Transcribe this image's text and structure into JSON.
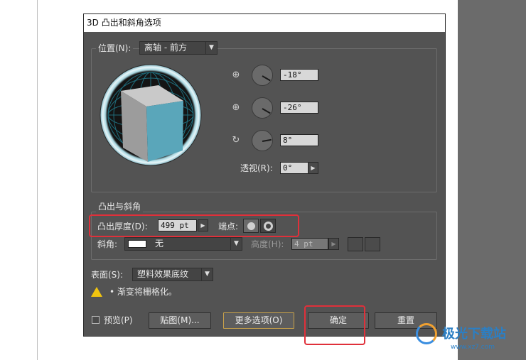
{
  "dialog": {
    "title": "3D 凸出和斜角选项",
    "position": {
      "label": "位置(N):",
      "selected": "离轴 - 前方",
      "rotation_x": "-18°",
      "rotation_y": "-26°",
      "rotation_z": "8°",
      "perspective_label": "透视(R):",
      "perspective_value": "0°"
    },
    "extrude": {
      "legend": "凸出与斜角",
      "depth_label": "凸出厚度(D):",
      "depth_value": "499 pt",
      "cap_label": "端点:",
      "bevel_label": "斜角:",
      "bevel_value": "无",
      "height_label": "高度(H):",
      "height_value": "4 pt"
    },
    "surface": {
      "label": "表面(S):",
      "selected": "塑料效果底纹"
    },
    "warning": "• 渐变将栅格化。",
    "buttons": {
      "preview": "预览(P)",
      "map": "贴图(M)...",
      "more": "更多选项(O)",
      "ok": "确定",
      "reset": "重置"
    }
  },
  "watermark": {
    "text": "极光下载站",
    "url": "www.xz7.com"
  },
  "colors": {
    "dialog_bg": "#535353",
    "cube_front": "#5aa6ba",
    "highlight": "#e0303a"
  },
  "icons": {
    "rot_x": "horizontal-axis-icon",
    "rot_y": "vertical-axis-icon",
    "rot_z": "rotate-axis-icon",
    "warning": "warning-icon"
  }
}
